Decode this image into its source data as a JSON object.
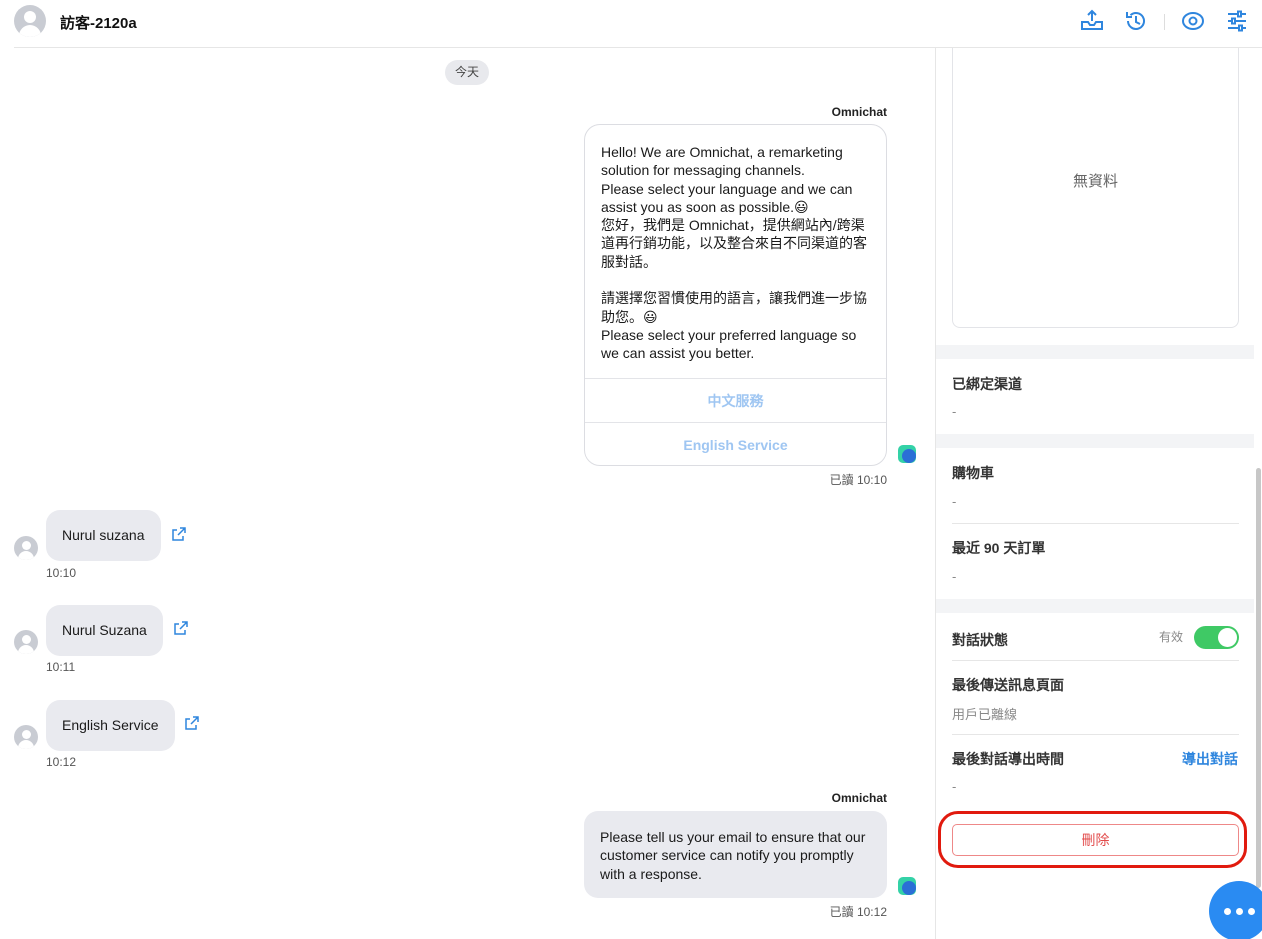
{
  "header": {
    "title": "訪客-2120a",
    "icons": [
      "inbox-upload-icon",
      "history-icon",
      "eye-icon",
      "sliders-icon"
    ],
    "accent": "#2f86de"
  },
  "chat": {
    "date_chip": "今天",
    "messages": [
      {
        "sender": "Omnichat",
        "text": "Hello! We are Omnichat, a remarketing solution for messaging channels.\nPlease select your language and we can assist you as soon as possible.😃\n您好，我們是 Omnichat，提供網站內/跨渠道再行銷功能，以及整合來自不同渠道的客服對話。\n\n請選擇您習慣使用的語言，讓我們進一步協助您。😃\nPlease select your preferred language so we can assist you better.",
        "buttons": [
          "中文服務",
          "English Service"
        ],
        "status": "已讀 10:10"
      },
      {
        "text": "Nurul suzana",
        "time": "10:10"
      },
      {
        "text": "Nurul Suzana",
        "time": "10:11"
      },
      {
        "text": "English Service",
        "time": "10:12"
      },
      {
        "sender": "Omnichat",
        "text": "Please tell us your email to ensure that our customer service can notify you promptly with a response.",
        "status": "已讀 10:12"
      }
    ]
  },
  "panel": {
    "no_data": "無資料",
    "bound_channels": {
      "label": "已綁定渠道",
      "value": "-"
    },
    "cart": {
      "label": "購物車",
      "value": "-"
    },
    "orders": {
      "label": "最近 90 天訂單",
      "value": "-"
    },
    "status": {
      "label": "對話狀態",
      "value": "有效",
      "toggle_on": true,
      "toggle_color": "#3fc965"
    },
    "last_page": {
      "label": "最後傳送訊息頁面",
      "value": "用戶已離線"
    },
    "last_export": {
      "label": "最後對話導出時間",
      "value": "-",
      "action": "導出對話"
    },
    "delete_label": "刪除",
    "highlight_color": "#e11a0e"
  }
}
